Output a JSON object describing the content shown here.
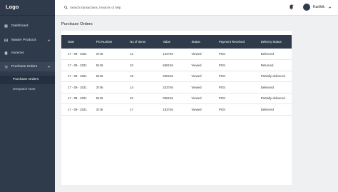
{
  "sidebar": {
    "logo": "Logo",
    "items": [
      {
        "label": "Dashboard"
      },
      {
        "label": "Master Products"
      },
      {
        "label": "Invoices"
      },
      {
        "label": "Purchase Orders"
      }
    ],
    "subitems": [
      {
        "label": "Purchase Orders"
      },
      {
        "label": "Despatch Note"
      }
    ]
  },
  "header": {
    "search_placeholder": "Search transactions, invoices or help",
    "user_name": "Karthik"
  },
  "page": {
    "title": "Purchase Orders"
  },
  "table": {
    "headers": [
      "Date",
      "PO Number",
      "No of Items",
      "Value",
      "Status",
      "Payment Received",
      "Delivery Status"
    ],
    "rows": [
      [
        "17 - 09 - 2021",
        "3746",
        "12",
        "133746",
        "Viewed",
        "POS",
        "Delivered"
      ],
      [
        "17 - 09 - 2021",
        "8126",
        "10",
        "658126",
        "Viewed",
        "POS",
        "Returned"
      ],
      [
        "17 - 09 - 2021",
        "8126",
        "18",
        "528126",
        "Viewed",
        "POS",
        "Partially delivered"
      ],
      [
        "17 - 09 - 2021",
        "3746",
        "14",
        "233746",
        "Viewed",
        "POS",
        "Delivered"
      ],
      [
        "17 - 09 - 2021",
        "8126",
        "40",
        "608126",
        "Viewed",
        "POS",
        "Partially delivered"
      ],
      [
        "17 - 09 - 2021",
        "3746",
        "17",
        "183746",
        "Viewed",
        "POS",
        "Delivered"
      ]
    ]
  },
  "colors": {
    "sidebar_bg": "#2f3a4a",
    "table_header_bg": "#2f3a4a",
    "page_bg": "#eef0f2"
  }
}
